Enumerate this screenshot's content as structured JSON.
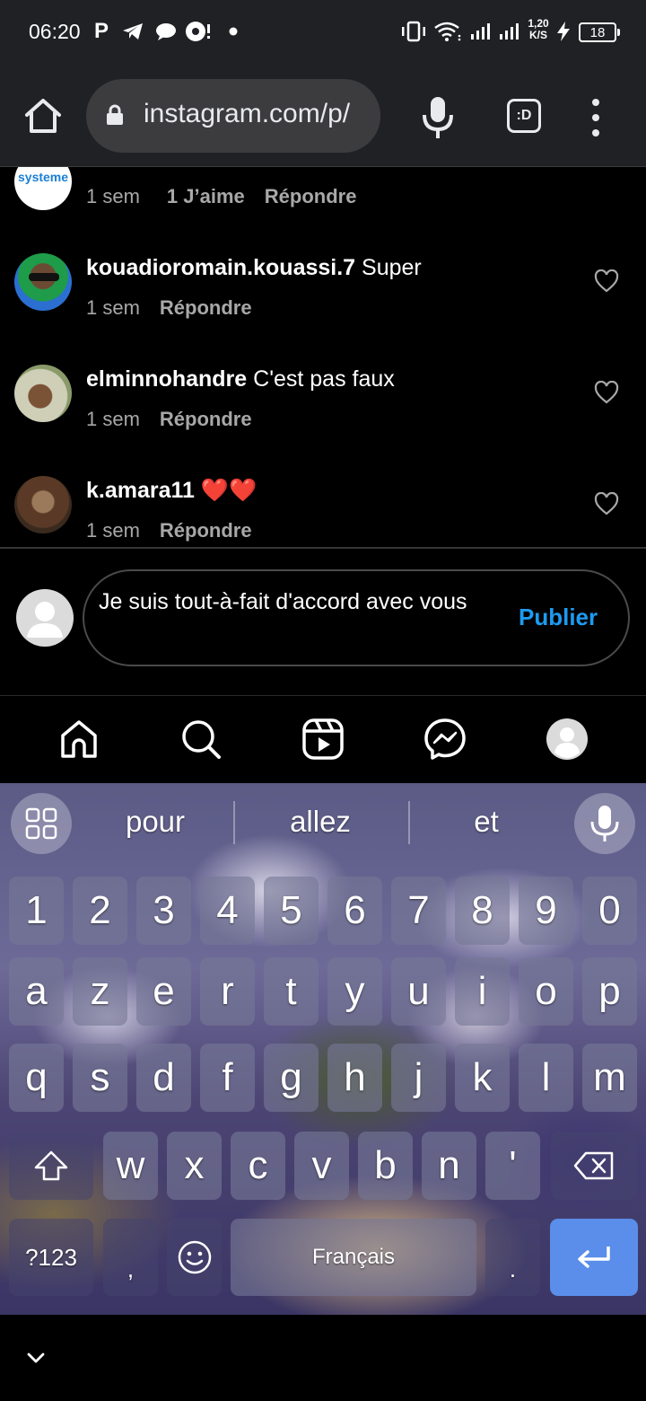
{
  "status_bar": {
    "time": "06:20",
    "net_speed_top": "1,20",
    "net_speed_bottom": "K/S",
    "battery": "18"
  },
  "browser": {
    "url": "instagram.com/p/",
    "tabs_label": ":D"
  },
  "comments": [
    {
      "username": "",
      "text": "",
      "time": "1 sem",
      "likes": "1 J’aime",
      "reply": "Répondre",
      "avatar_text": "systeme"
    },
    {
      "username": "kouadioromain.kouassi.7",
      "text": "Super",
      "time": "1 sem",
      "reply": "Répondre"
    },
    {
      "username": "elminnohandre",
      "text": "C'est pas faux",
      "time": "1 sem",
      "reply": "Répondre"
    },
    {
      "username": "k.amara11",
      "text": "❤️❤️",
      "time": "1 sem",
      "reply": "Répondre"
    }
  ],
  "compose": {
    "value": "Je suis tout-à-fait d'accord avec vous",
    "publish_label": "Publier",
    "accent_color": "#1d9bf0"
  },
  "bottom_nav": [
    "home-icon",
    "search-icon",
    "reels-icon",
    "messenger-icon",
    "profile-icon"
  ],
  "keyboard": {
    "suggestions": [
      "pour",
      "allez",
      "et"
    ],
    "row_numbers": [
      "1",
      "2",
      "3",
      "4",
      "5",
      "6",
      "7",
      "8",
      "9",
      "0"
    ],
    "row1": [
      "a",
      "z",
      "e",
      "r",
      "t",
      "y",
      "u",
      "i",
      "o",
      "p"
    ],
    "row2": [
      "q",
      "s",
      "d",
      "f",
      "g",
      "h",
      "j",
      "k",
      "l",
      "m"
    ],
    "row3": [
      "w",
      "x",
      "c",
      "v",
      "b",
      "n",
      "'"
    ],
    "symbols_label": "?123",
    "comma": ",",
    "space_label": "Français",
    "period": "."
  }
}
